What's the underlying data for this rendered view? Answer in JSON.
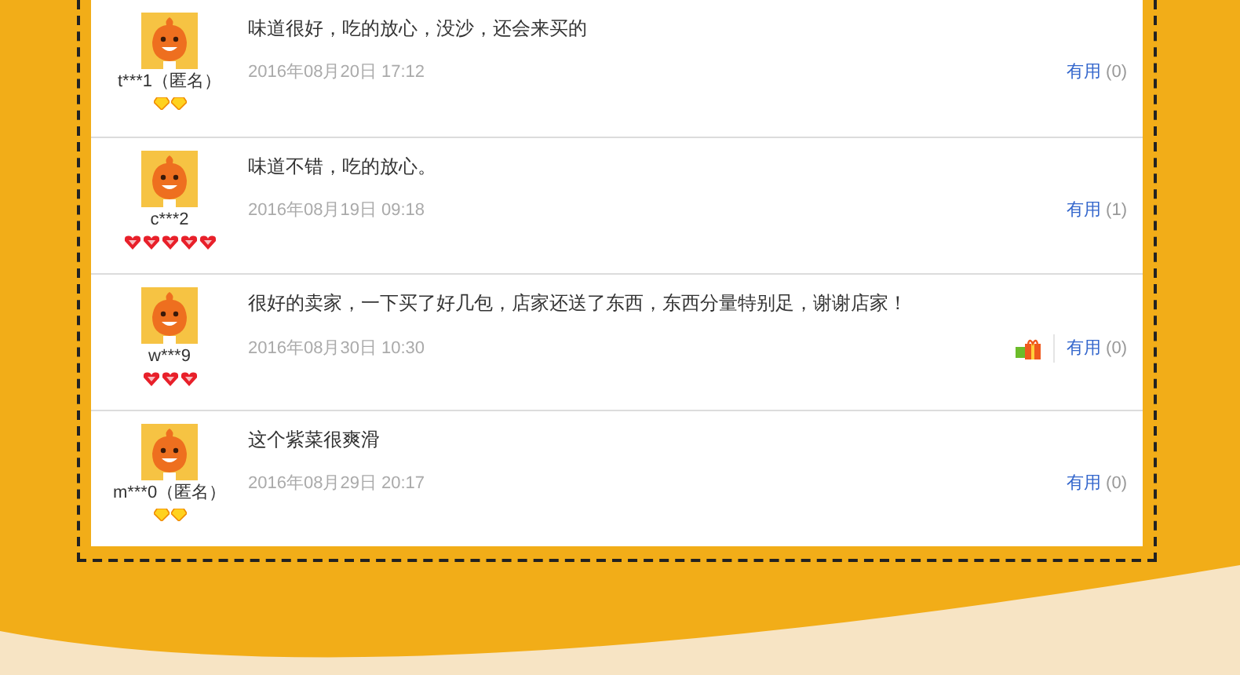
{
  "reviews": [
    {
      "user": "t***1（匿名）",
      "rank_icons": [
        {
          "kind": "diamond"
        },
        {
          "kind": "diamond"
        }
      ],
      "text": "味道很好，吃的放心，没沙，还会来买的",
      "time": "2016年08月20日 17:12",
      "gift": false,
      "useful_label": "有用",
      "useful_count": "(0)"
    },
    {
      "user": "c***2",
      "rank_icons": [
        {
          "kind": "heart"
        },
        {
          "kind": "heart"
        },
        {
          "kind": "heart"
        },
        {
          "kind": "heart"
        },
        {
          "kind": "heart"
        }
      ],
      "text": "味道不错，吃的放心。",
      "time": "2016年08月19日 09:18",
      "gift": false,
      "useful_label": "有用",
      "useful_count": "(1)"
    },
    {
      "user": "w***9",
      "rank_icons": [
        {
          "kind": "heart"
        },
        {
          "kind": "heart"
        },
        {
          "kind": "heart"
        }
      ],
      "text": "很好的卖家，一下买了好几包，店家还送了东西，东西分量特别足，谢谢店家！",
      "time": "2016年08月30日 10:30",
      "gift": true,
      "useful_label": "有用",
      "useful_count": "(0)"
    },
    {
      "user": "m***0（匿名）",
      "rank_icons": [
        {
          "kind": "diamond"
        },
        {
          "kind": "diamond"
        }
      ],
      "text": "这个紫菜很爽滑",
      "time": "2016年08月29日 20:17",
      "gift": false,
      "useful_label": "有用",
      "useful_count": "(0)"
    }
  ]
}
